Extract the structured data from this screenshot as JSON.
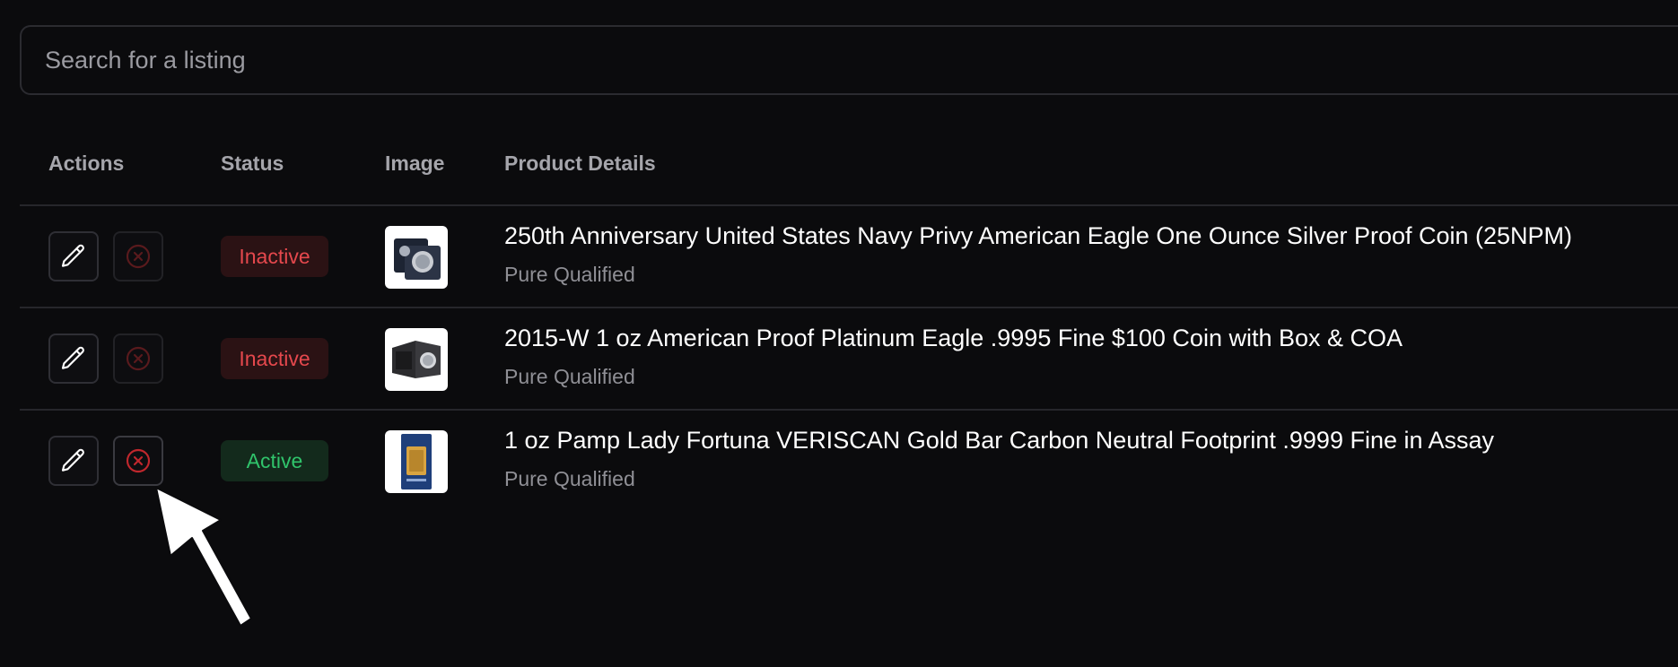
{
  "search": {
    "placeholder": "Search for a listing",
    "value": ""
  },
  "table": {
    "headers": {
      "actions": "Actions",
      "status": "Status",
      "image": "Image",
      "details": "Product Details"
    },
    "rows": [
      {
        "status": "Inactive",
        "status_kind": "inactive",
        "title": "250th Anniversary United States Navy Privy American Eagle One Ounce Silver Proof Coin (25NPM)",
        "subtitle": "Pure Qualified",
        "image_icon": "silver-coin-set-thumbnail"
      },
      {
        "status": "Inactive",
        "status_kind": "inactive",
        "title": "2015-W 1 oz American Proof Platinum Eagle .9995 Fine $100 Coin with Box & COA",
        "subtitle": "Pure Qualified",
        "image_icon": "coin-box-thumbnail"
      },
      {
        "status": "Active",
        "status_kind": "active",
        "title": "1 oz Pamp Lady Fortuna VERISCAN Gold Bar Carbon Neutral Footprint .9999 Fine in Assay",
        "subtitle": "Pure Qualified",
        "image_icon": "gold-bar-assay-thumbnail"
      }
    ]
  },
  "icons": {
    "edit": "pencil-icon",
    "delete": "close-circle-icon",
    "pointer": "arrow-cursor-icon"
  },
  "colors": {
    "background": "#0b0b0d",
    "inactive_text": "#e5484d",
    "inactive_bg": "#2b1214",
    "active_text": "#30c46b",
    "active_bg": "#132a1c",
    "delete_icon": "#b4262c"
  }
}
